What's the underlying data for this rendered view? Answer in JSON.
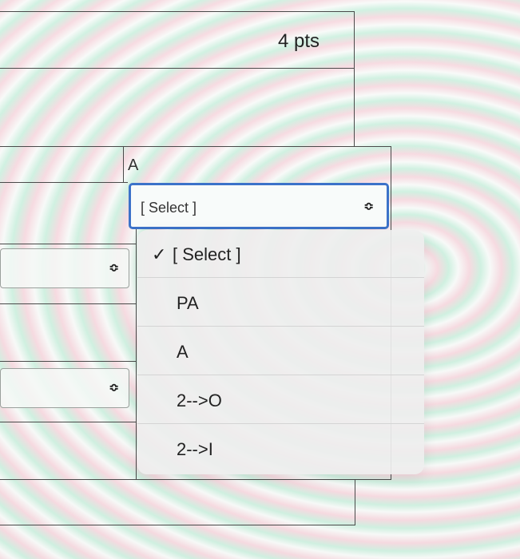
{
  "question": {
    "points": "4 pts",
    "column_header": "A"
  },
  "main_select": {
    "value": "[ Select ]",
    "chevron": "chevron-up-down-icon"
  },
  "dropdown": {
    "options": [
      {
        "label": "[ Select ]",
        "checked": true,
        "check": "✓"
      },
      {
        "label": "PA",
        "checked": false
      },
      {
        "label": "A",
        "checked": false
      },
      {
        "label": "2-->O",
        "checked": false
      },
      {
        "label": "2-->I",
        "checked": false
      }
    ]
  },
  "side_selects": [
    {
      "chevron": "chevron-up-down-icon"
    },
    {
      "chevron": "chevron-up-down-icon"
    }
  ]
}
